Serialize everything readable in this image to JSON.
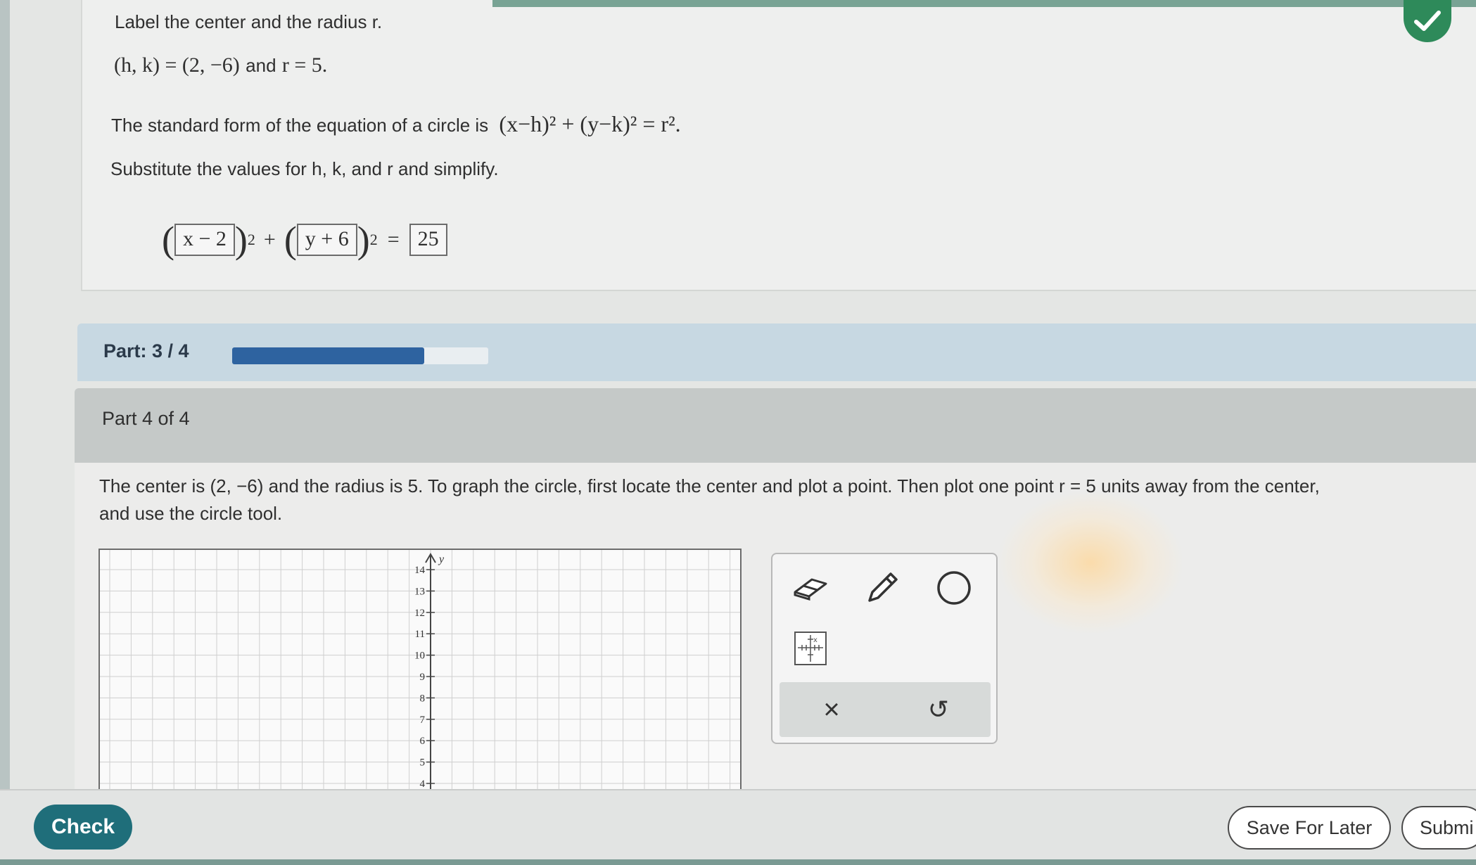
{
  "top_section": {
    "instruction": "Label the center and the radius r.",
    "center_eq_prefix": "(h, k) = (2, −6)",
    "and_word": "and",
    "radius_eq": "r = 5.",
    "standard_form_text": "The standard form of the equation of a circle is",
    "standard_form_eq": "(x−h)² + (y−k)² = r².",
    "substitute_text": "Substitute the values for h, k, and r and simplify.",
    "answer_box_1": "x − 2",
    "answer_box_2": "y + 6",
    "answer_box_3": "25",
    "plus": "+",
    "equals": "=",
    "exp": "2"
  },
  "progress": {
    "label": "Part: 3 / 4",
    "fraction": 0.75
  },
  "part": {
    "title": "Part 4 of 4",
    "instructions_line1": "The center is (2, −6) and the radius is 5. To graph the circle, first locate the center and plot a point. Then plot one point r = 5 units away from the center,",
    "instructions_line2": "and use the circle tool."
  },
  "graph": {
    "y_axis_label": "y",
    "y_ticks": [
      "14",
      "13",
      "12",
      "11",
      "10",
      "9",
      "8",
      "7",
      "6",
      "5",
      "4"
    ]
  },
  "toolbox": {
    "tools": [
      "eraser-icon",
      "pencil-icon",
      "circle-tool-icon",
      "graph-table-icon"
    ],
    "clear_symbol": "×",
    "undo_symbol": "↺"
  },
  "footer": {
    "check_label": "Check",
    "save_label": "Save For Later",
    "submit_label": "Submi"
  },
  "colors": {
    "accent_green": "#2e8a5a",
    "progress_blue": "#2e63a0",
    "check_button": "#1f6e7a"
  }
}
